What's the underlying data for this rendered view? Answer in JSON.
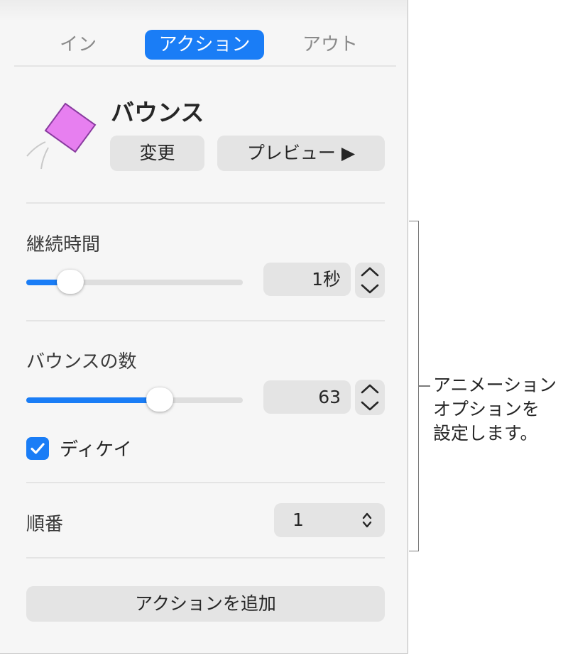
{
  "tabs": [
    {
      "label": "イン",
      "active": false
    },
    {
      "label": "アクション",
      "active": true
    },
    {
      "label": "アウト",
      "active": false
    }
  ],
  "effect": {
    "title": "バウンス",
    "change_label": "変更",
    "preview_label": "プレビュー ▶",
    "icon": "bounce-diamond-icon",
    "icon_color": "#e77ff0"
  },
  "duration": {
    "label": "継続時間",
    "value": "1秒",
    "slider_fraction": 0.2
  },
  "bounces": {
    "label": "バウンスの数",
    "value": "63",
    "slider_fraction": 0.62
  },
  "decay": {
    "label": "ディケイ",
    "checked": true
  },
  "order": {
    "label": "順番",
    "value": "1"
  },
  "add_action_label": "アクションを追加",
  "callout": {
    "line1": "アニメーション",
    "line2": "オプションを",
    "line3": "設定します。"
  },
  "colors": {
    "accent": "#1a7df6",
    "panel_bg": "#f6f6f6",
    "control_bg": "#e4e4e4"
  }
}
